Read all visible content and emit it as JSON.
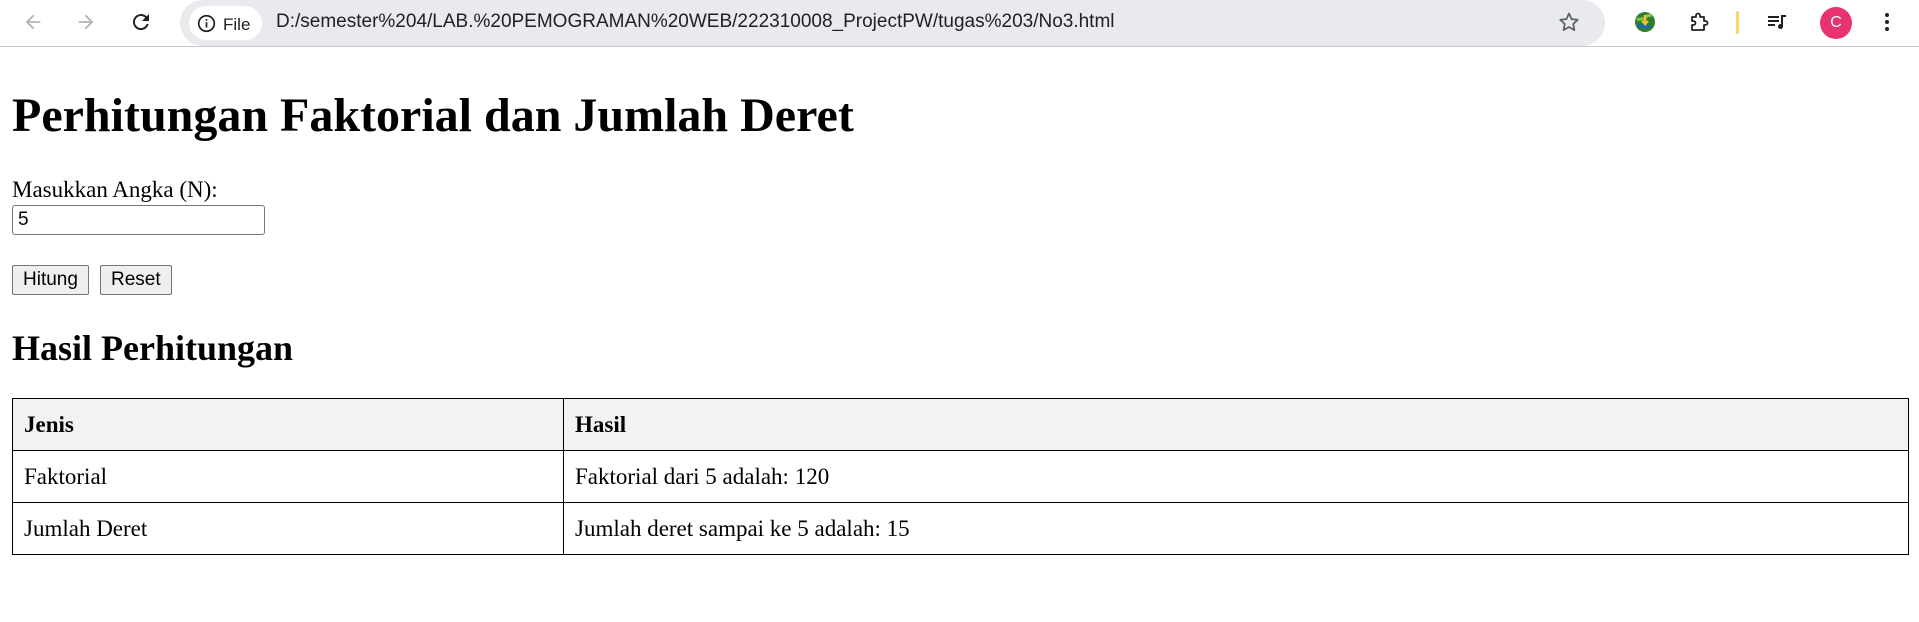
{
  "browser": {
    "chip_label": "File",
    "url": "D:/semester%204/LAB.%20PEMOGRAMAN%20WEB/222310008_ProjectPW/tugas%203/No3.html",
    "avatar_letter": "C",
    "icons": [
      "back-icon",
      "forward-icon",
      "reload-icon",
      "info-icon",
      "star-icon",
      "extension-globe-icon",
      "puzzle-icon",
      "media-queue-icon",
      "profile-avatar",
      "menu-icon"
    ]
  },
  "page": {
    "title": "Perhitungan Faktorial dan Jumlah Deret",
    "input_label": "Masukkan Angka (N):",
    "input_value": "5",
    "hitung_label": "Hitung",
    "reset_label": "Reset",
    "result_heading": "Hasil Perhitungan"
  },
  "table": {
    "headers": [
      "Jenis",
      "Hasil"
    ],
    "rows": [
      [
        "Faktorial",
        "Faktorial dari 5 adalah: 120"
      ],
      [
        "Jumlah Deret",
        "Jumlah deret sampai ke 5 adalah: 15"
      ]
    ]
  },
  "colors": {
    "avatar": "#e8336e",
    "omnibox": "#e8eaed",
    "header_cell": "#f2f2f2"
  }
}
